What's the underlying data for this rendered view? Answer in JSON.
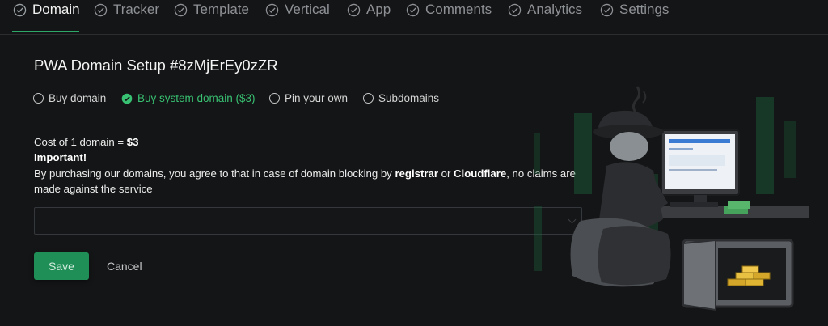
{
  "tabs": [
    {
      "label": "Domain",
      "icon": "check-circle-icon",
      "active": true
    },
    {
      "label": "Tracker",
      "icon": "check-circle-icon"
    },
    {
      "label": "Template",
      "icon": "check-circle-icon"
    },
    {
      "label": "Vertical",
      "icon": "check-circle-icon"
    },
    {
      "label": "App",
      "icon": "check-circle-icon"
    },
    {
      "label": "Comments",
      "icon": "check-circle-icon"
    },
    {
      "label": "Analytics",
      "icon": "check-circle-icon"
    },
    {
      "label": "Settings",
      "icon": "check-circle-icon"
    }
  ],
  "page": {
    "title": "PWA Domain Setup #8zMjErEy0zZR"
  },
  "domain_options": [
    {
      "label": "Buy domain",
      "selected": false
    },
    {
      "label": "Buy system domain ($3)",
      "selected": true
    },
    {
      "label": "Pin your own",
      "selected": false
    },
    {
      "label": "Subdomains",
      "selected": false
    }
  ],
  "info": {
    "cost_prefix": "Cost of 1 domain = ",
    "cost_value": "$3",
    "important": "Important!",
    "notice_part1": "By purchasing our domains, you agree to that in case of domain blocking by ",
    "registrar": "registrar",
    "notice_part2": " or ",
    "cloudflare": "Cloudflare",
    "notice_part3": ", no claims are made against the service"
  },
  "domain_select": {
    "value": ""
  },
  "actions": {
    "save_label": "Save",
    "cancel_label": "Cancel"
  },
  "colors": {
    "accent": "#2ea868",
    "background": "#141516",
    "save_button": "#1f8f57"
  }
}
